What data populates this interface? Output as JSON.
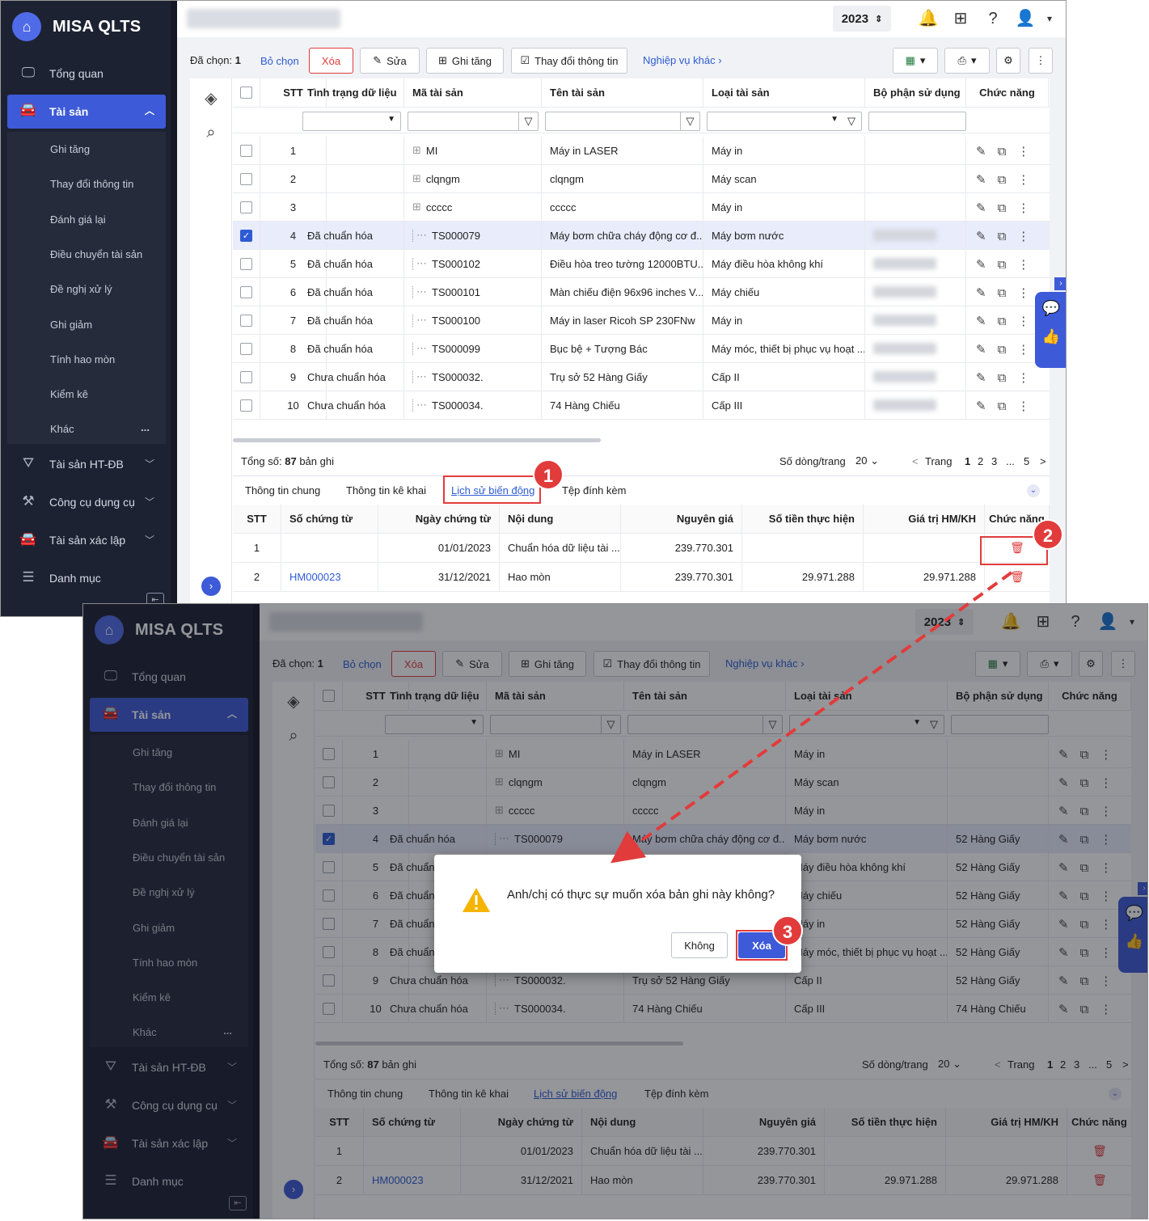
{
  "app": {
    "name": "MISA QLTS"
  },
  "nav": {
    "overview": "Tổng quan",
    "assets": "Tài sản",
    "sub": [
      "Ghi tăng",
      "Thay đổi thông tin",
      "Đánh giá lại",
      "Điều chuyển tài sản",
      "Đề nghị xử lý",
      "Ghi giảm",
      "Tính hao mòn",
      "Kiểm kê",
      "Khác"
    ],
    "sub_more": "...",
    "infra": "Tài sản HT-ĐB",
    "tools": "Công cụ dụng cụ",
    "established": "Tài sản xác lập",
    "catalog": "Danh mục"
  },
  "topbar": {
    "year": "2023"
  },
  "toolbar": {
    "selected_label": "Đã chọn:",
    "selected_count": "1",
    "deselect": "Bỏ chọn",
    "delete": "Xóa",
    "edit": "Sửa",
    "increase": "Ghi tăng",
    "change_info": "Thay đổi thông tin",
    "other": "Nghiệp vụ khác"
  },
  "grid": {
    "headers": [
      "STT",
      "Tình trạng dữ liệu",
      "Mã tài sản",
      "Tên tài sản",
      "Loại tài sản",
      "Bộ phận sử dụng",
      "Chức năng"
    ],
    "rows": [
      {
        "stt": "1",
        "status": "",
        "code": "MI",
        "name": "Máy in LASER",
        "type": "Máy in",
        "dept": "",
        "tree": "plus"
      },
      {
        "stt": "2",
        "status": "",
        "code": "clqngm",
        "name": "clqngm",
        "type": "Máy scan",
        "dept": "",
        "tree": "plus"
      },
      {
        "stt": "3",
        "status": "",
        "code": "ccccc",
        "name": "ccccc",
        "type": "Máy in",
        "dept": "",
        "tree": "plus"
      },
      {
        "stt": "4",
        "status": "Đã chuẩn hóa",
        "code": "TS000079",
        "name": "Máy bơm chữa cháy động cơ đ...",
        "type": "Máy bơm nước",
        "dept": "52 Hàng Giấy",
        "tree": "line",
        "selected": true
      },
      {
        "stt": "5",
        "status": "Đã chuẩn hóa",
        "code": "TS000102",
        "name": "Điều hòa treo tường 12000BTU...",
        "type": "Máy điều hòa không khí",
        "dept": "52 Hàng Giấy",
        "tree": "line"
      },
      {
        "stt": "6",
        "status": "Đã chuẩn hóa",
        "code": "TS000101",
        "name": "Màn chiếu điện 96x96 inches V...",
        "type": "Máy chiếu",
        "dept": "52 Hàng Giấy",
        "tree": "line"
      },
      {
        "stt": "7",
        "status": "Đã chuẩn hóa",
        "code": "TS000100",
        "name": "Máy in laser Ricoh SP 230FNw",
        "type": "Máy in",
        "dept": "52 Hàng Giấy",
        "tree": "line"
      },
      {
        "stt": "8",
        "status": "Đã chuẩn hóa",
        "code": "TS000099",
        "name": "Bục bệ + Tượng Bác",
        "type": "Máy móc, thiết bị phục vụ hoạt ...",
        "dept": "52 Hàng Giấy",
        "tree": "line"
      },
      {
        "stt": "9",
        "status": "Chưa chuẩn hóa",
        "code": "TS000032.",
        "name": "Trụ sở 52 Hàng Giấy",
        "type": "Cấp II",
        "dept": "52 Hàng Giấy",
        "tree": "line"
      },
      {
        "stt": "10",
        "status": "Chưa chuẩn hóa",
        "code": "TS000034.",
        "name": "74 Hàng Chiếu",
        "type": "Cấp III",
        "dept": "74 Hàng Chiếu",
        "tree": "line"
      }
    ]
  },
  "pager": {
    "total_label": "Tổng số:",
    "total": "87",
    "total_suffix": "bản ghi",
    "per_page_label": "Số dòng/trang",
    "per_page": "20",
    "prev": "<",
    "page_label": "Trang",
    "pages": [
      "1",
      "2",
      "3",
      "...",
      "5"
    ],
    "next": ">"
  },
  "detail_tabs": [
    "Thông tin chung",
    "Thông tin kê khai",
    "Lịch sử biến động",
    "Tệp đính kèm"
  ],
  "history": {
    "headers": [
      "STT",
      "Số chứng từ",
      "Ngày chứng từ",
      "Nội dung",
      "Nguyên giá",
      "Số tiền thực hiện",
      "Giá trị HM/KH",
      "Chức năng"
    ],
    "rows": [
      {
        "stt": "1",
        "doc": "",
        "date": "01/01/2023",
        "content": "Chuẩn hóa dữ liệu tài ...",
        "cost": "239.770.301",
        "amount": "",
        "value": ""
      },
      {
        "stt": "2",
        "doc": "HM000023",
        "date": "31/12/2021",
        "content": "Hao mòn",
        "cost": "239.770.301",
        "amount": "29.971.288",
        "value": "29.971.288"
      }
    ]
  },
  "dialog": {
    "message": "Anh/chị có thực sự muốn xóa bản ghi này không?",
    "no": "Không",
    "yes": "Xóa"
  },
  "steps": [
    "1",
    "2",
    "3"
  ],
  "colors": {
    "accent": "#3d5ad8",
    "sidebar": "#1d2233",
    "danger": "#e23b3b"
  }
}
